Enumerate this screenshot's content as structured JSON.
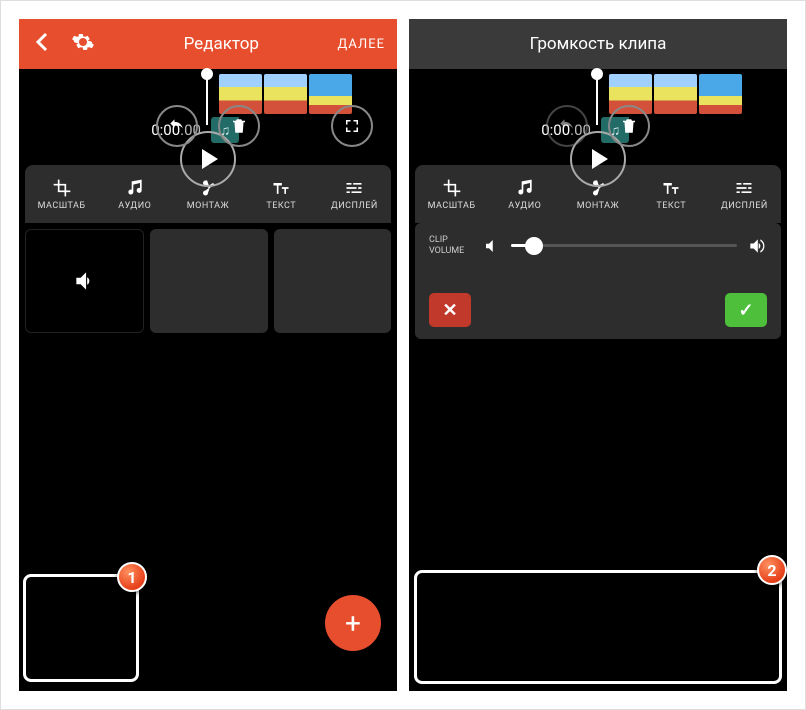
{
  "left": {
    "header": {
      "title": "Редактор",
      "next": "ДАЛЕЕ"
    },
    "timecode": {
      "main": "0:00",
      "frac": ".00"
    },
    "tabs": {
      "crop": "МАСШТАБ",
      "audio": "АУДИО",
      "montage": "МОНТАЖ",
      "text": "ТЕКСТ",
      "display": "ДИСПЛЕЙ"
    },
    "fab": "+",
    "badge": "1"
  },
  "right": {
    "header": {
      "title": "Громкость клипа"
    },
    "timecode": {
      "main": "0:00",
      "frac": ".00"
    },
    "tabs": {
      "crop": "МАСШТАБ",
      "audio": "АУДИО",
      "montage": "МОНТАЖ",
      "text": "ТЕКСТ",
      "display": "ДИСПЛЕЙ"
    },
    "vol": {
      "label1": "CLIP",
      "label2": "VOLUME"
    },
    "cancel": "✕",
    "confirm": "✓",
    "badge": "2"
  }
}
